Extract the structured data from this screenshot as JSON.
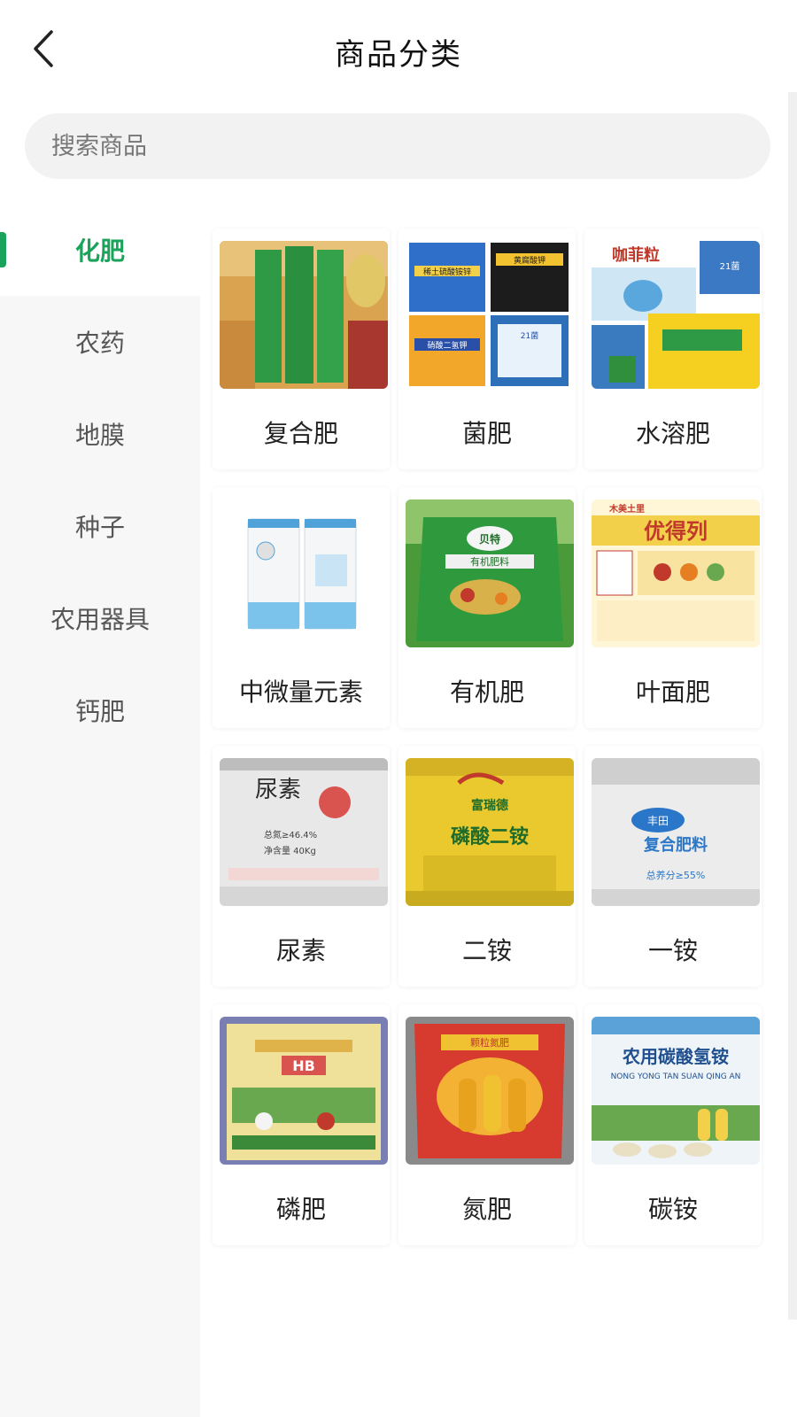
{
  "header": {
    "title": "商品分类",
    "back_icon": "chevron-left-icon"
  },
  "search": {
    "placeholder": "搜索商品",
    "value": ""
  },
  "sidebar": {
    "items": [
      {
        "label": "化肥",
        "active": true
      },
      {
        "label": "农药",
        "active": false
      },
      {
        "label": "地膜",
        "active": false
      },
      {
        "label": "种子",
        "active": false
      },
      {
        "label": "农用器具",
        "active": false
      },
      {
        "label": "钙肥",
        "active": false
      }
    ]
  },
  "products": [
    {
      "label": "复合肥",
      "image_text": []
    },
    {
      "label": "菌肥",
      "image_text": [
        "稀土硫酸铵锌",
        "黄腐酸钾",
        "硝酸二氢钾",
        "21菌"
      ]
    },
    {
      "label": "水溶肥",
      "image_text": [
        "咖菲粒",
        "21菌"
      ]
    },
    {
      "label": "中微量元素",
      "image_text": []
    },
    {
      "label": "有机肥",
      "image_text": [
        "贝特",
        "有机肥料"
      ]
    },
    {
      "label": "叶面肥",
      "image_text": [
        "木美土里",
        "优得列"
      ]
    },
    {
      "label": "尿素",
      "image_text": [
        "尿素",
        "总氮≥46.4%",
        "净含量 40Kg"
      ]
    },
    {
      "label": "二铵",
      "image_text": [
        "富瑞德",
        "磷酸二铵"
      ]
    },
    {
      "label": "一铵",
      "image_text": [
        "丰田",
        "复合肥料",
        "总养分≥55%"
      ]
    },
    {
      "label": "磷肥",
      "image_text": [
        "HB"
      ]
    },
    {
      "label": "氮肥",
      "image_text": [
        "颗粒氮肥"
      ]
    },
    {
      "label": "碳铵",
      "image_text": [
        "农用碳酸氢铵",
        "NONG YONG TAN SUAN QING AN"
      ]
    }
  ],
  "colors": {
    "accent": "#1aa35a",
    "sidebar_bg": "#f7f7f7",
    "search_bg": "#f2f2f2"
  }
}
